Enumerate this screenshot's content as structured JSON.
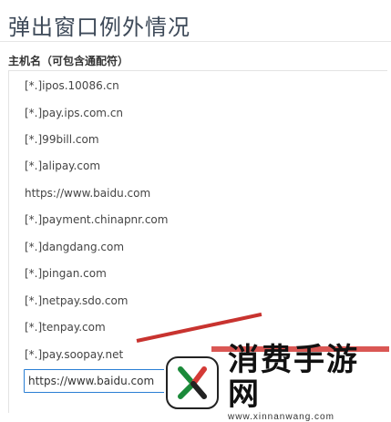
{
  "page": {
    "title": "弹出窗口例外情况",
    "field_label": "主机名（可包含通配符）"
  },
  "hosts": [
    "[*.]ipos.10086.cn",
    "[*.]pay.ips.com.cn",
    "[*.]99bill.com",
    "[*.]alipay.com",
    "https://www.baidu.com",
    "[*.]payment.chinapnr.com",
    "[*.]dangdang.com",
    "[*.]pingan.com",
    "[*.]netpay.sdo.com",
    "[*.]tenpay.com",
    "[*.]pay.soopay.net"
  ],
  "input": {
    "value": "https://www.baidu.com"
  },
  "watermark": {
    "brand": "消费手游网",
    "url": "www.xinnanwang.com"
  },
  "colors": {
    "accent": "#2a7fd4",
    "watermark_red": "#d43a36"
  }
}
